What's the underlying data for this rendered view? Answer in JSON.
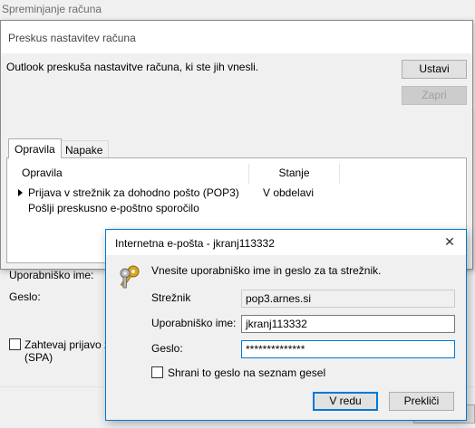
{
  "background_window": {
    "title": "Spreminjanje računa",
    "username_label": "Uporabniško ime:",
    "password_label": "Geslo:",
    "spa_label_line1": "Zahtevaj prijavo z",
    "spa_label_line2": "(SPA)"
  },
  "test_dialog": {
    "title": "Preskus nastavitev računa",
    "message": "Outlook preskuša nastavitve računa, ki ste jih vnesli.",
    "stop_button": "Ustavi",
    "close_button": "Zapri",
    "tabs": [
      "Opravila",
      "Napake"
    ],
    "columns": [
      "Opravila",
      "Stanje"
    ],
    "tasks": [
      {
        "name": "Prijava v strežnik za dohodno pošto (POP3)",
        "status": "V obdelavi",
        "active": true
      },
      {
        "name": "Pošlji preskusno e-poštno sporočilo",
        "status": "",
        "active": false
      }
    ]
  },
  "prompt": {
    "title": "Internetna e-pošta - jkranj113332",
    "close_glyph": "✕",
    "message": "Vnesite uporabniško ime in geslo za ta strežnik.",
    "server_label": "Strežnik",
    "server_value": "pop3.arnes.si",
    "username_label": "Uporabniško ime:",
    "username_value": "jkranj113332",
    "password_label": "Geslo:",
    "password_value": "**************",
    "save_checkbox_label": "Shrani to geslo na seznam gesel",
    "save_checked": false,
    "ok_button": "V redu",
    "cancel_button": "Prekliči",
    "icon": "keys-icon"
  }
}
